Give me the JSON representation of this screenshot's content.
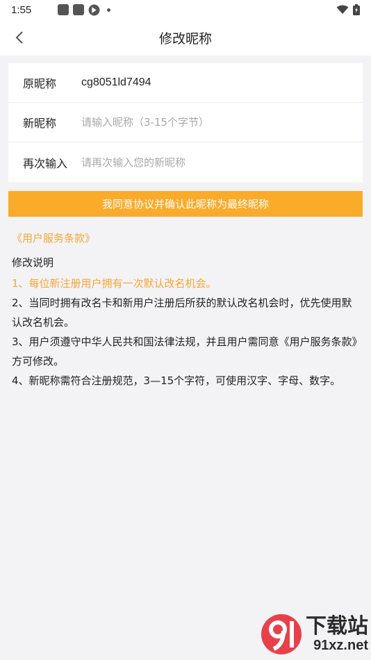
{
  "status_bar": {
    "time": "1:55",
    "icons": [
      "app-icon",
      "app-icon",
      "app-icon",
      "notification-dot"
    ],
    "right_icons": [
      "wifi-icon",
      "battery-icon"
    ]
  },
  "header": {
    "title": "修改昵称",
    "back_icon": "chevron-left-icon"
  },
  "form": {
    "original": {
      "label": "原昵称",
      "value": "cg8051ld7494"
    },
    "new": {
      "label": "新昵称",
      "placeholder": "请输入昵称（3-15个字节）"
    },
    "confirm": {
      "label": "再次输入",
      "placeholder": "请再次输入您的新昵称"
    }
  },
  "confirm_button": "我同意协议并确认此昵称为最终昵称",
  "terms_link": "《用户服务条款》",
  "notes": {
    "title": "修改说明",
    "items": [
      "1、每位新注册用户拥有一次默认改名机会。",
      "2、当同时拥有改名卡和新用户注册后所获的默认改名机会时，优先使用默认改名机会。",
      "3、用户须遵守中华人民共和国法律法规，并且用户需同意《用户服务条款》方可修改。",
      "4、新昵称需符合注册规范，3—15个字符，可使用汉字、字母、数字。"
    ]
  },
  "watermark": {
    "line1": "下载站",
    "line2": "91xz.net"
  },
  "colors": {
    "accent": "#fbab2a",
    "link": "#f6a634",
    "background": "#f3f3f5"
  }
}
